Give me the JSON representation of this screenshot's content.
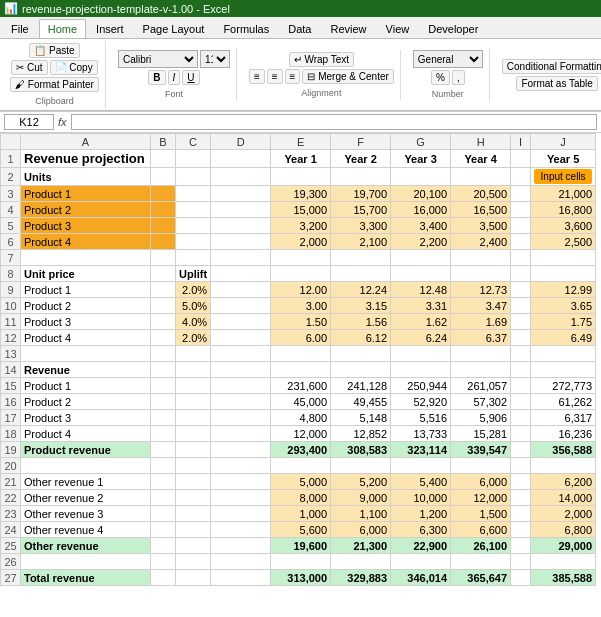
{
  "title": "revenue-projection-template-v-1.00 - Excel",
  "tabs": [
    "File",
    "Home",
    "Insert",
    "Page Layout",
    "Formulas",
    "Data",
    "Review",
    "View",
    "Developer"
  ],
  "active_tab": "Home",
  "cell_ref": "K12",
  "formula": "",
  "columns": [
    "A",
    "B",
    "C",
    "D",
    "E",
    "F",
    "G",
    "H",
    "I",
    "J"
  ],
  "input_cells_label": "Input cells",
  "rows": [
    {
      "row": 1,
      "a": "Revenue projection",
      "d": "",
      "e": "Year 1",
      "f": "Year 2",
      "g": "Year 3",
      "h": "Year 4",
      "i": "",
      "j": "Year 5"
    },
    {
      "row": 2,
      "a": "Units",
      "d": "",
      "e": "",
      "f": "",
      "g": "",
      "h": "",
      "i": "",
      "j": ""
    },
    {
      "row": 3,
      "a": "Product 1",
      "d": "",
      "e": "19,300",
      "f": "19,700",
      "g": "20,100",
      "h": "20,500",
      "i": "",
      "j": "21,000"
    },
    {
      "row": 4,
      "a": "Product 2",
      "d": "",
      "e": "15,000",
      "f": "15,700",
      "g": "16,000",
      "h": "16,500",
      "i": "",
      "j": "16,800"
    },
    {
      "row": 5,
      "a": "Product 3",
      "d": "",
      "e": "3,200",
      "f": "3,300",
      "g": "3,400",
      "h": "3,500",
      "i": "",
      "j": "3,600"
    },
    {
      "row": 6,
      "a": "Product 4",
      "d": "",
      "e": "2,000",
      "f": "2,100",
      "g": "2,200",
      "h": "2,400",
      "i": "",
      "j": "2,500"
    },
    {
      "row": 7,
      "a": "",
      "d": "",
      "e": "",
      "f": "",
      "g": "",
      "h": "",
      "i": "",
      "j": ""
    },
    {
      "row": 8,
      "a": "Unit price",
      "b": "",
      "c": "Uplift",
      "d": "",
      "e": "",
      "f": "",
      "g": "",
      "h": "",
      "i": "",
      "j": ""
    },
    {
      "row": 9,
      "a": "Product 1",
      "c": "2.0%",
      "d": "",
      "e": "12.00",
      "f": "12.24",
      "g": "12.48",
      "h": "12.73",
      "i": "",
      "j": "12.99"
    },
    {
      "row": 10,
      "a": "Product 2",
      "c": "5.0%",
      "d": "",
      "e": "3.00",
      "f": "3.15",
      "g": "3.31",
      "h": "3.47",
      "i": "",
      "j": "3.65"
    },
    {
      "row": 11,
      "a": "Product 3",
      "c": "4.0%",
      "d": "",
      "e": "1.50",
      "f": "1.56",
      "g": "1.62",
      "h": "1.69",
      "i": "",
      "j": "1.75"
    },
    {
      "row": 12,
      "a": "Product 4",
      "c": "2.0%",
      "d": "",
      "e": "6.00",
      "f": "6.12",
      "g": "6.24",
      "h": "6.37",
      "i": "",
      "j": "6.49"
    },
    {
      "row": 13,
      "a": "",
      "d": "",
      "e": "",
      "f": "",
      "g": "",
      "h": "",
      "i": "",
      "j": ""
    },
    {
      "row": 14,
      "a": "Revenue",
      "d": "",
      "e": "",
      "f": "",
      "g": "",
      "h": "",
      "i": "",
      "j": ""
    },
    {
      "row": 15,
      "a": "Product 1",
      "d": "",
      "e": "231,600",
      "f": "241,128",
      "g": "250,944",
      "h": "261,057",
      "i": "",
      "j": "272,773"
    },
    {
      "row": 16,
      "a": "Product 2",
      "d": "",
      "e": "45,000",
      "f": "49,455",
      "g": "52,920",
      "h": "57,302",
      "i": "",
      "j": "61,262"
    },
    {
      "row": 17,
      "a": "Product 3",
      "d": "",
      "e": "4,800",
      "f": "5,148",
      "g": "5,516",
      "h": "5,906",
      "i": "",
      "j": "6,317"
    },
    {
      "row": 18,
      "a": "Product 4",
      "d": "",
      "e": "12,000",
      "f": "12,852",
      "g": "13,733",
      "h": "15,281",
      "i": "",
      "j": "16,236"
    },
    {
      "row": 19,
      "a": "Product revenue",
      "d": "",
      "e": "293,400",
      "f": "308,583",
      "g": "323,114",
      "h": "339,547",
      "i": "",
      "j": "356,588"
    },
    {
      "row": 20,
      "a": "",
      "d": "",
      "e": "",
      "f": "",
      "g": "",
      "h": "",
      "i": "",
      "j": ""
    },
    {
      "row": 21,
      "a": "Other revenue 1",
      "d": "",
      "e": "5,000",
      "f": "5,200",
      "g": "5,400",
      "h": "6,000",
      "i": "",
      "j": "6,200"
    },
    {
      "row": 22,
      "a": "Other revenue 2",
      "d": "",
      "e": "8,000",
      "f": "9,000",
      "g": "10,000",
      "h": "12,000",
      "i": "",
      "j": "14,000"
    },
    {
      "row": 23,
      "a": "Other revenue 3",
      "d": "",
      "e": "1,000",
      "f": "1,100",
      "g": "1,200",
      "h": "1,500",
      "i": "",
      "j": "2,000"
    },
    {
      "row": 24,
      "a": "Other revenue 4",
      "d": "",
      "e": "5,600",
      "f": "6,000",
      "g": "6,300",
      "h": "6,600",
      "i": "",
      "j": "6,800"
    },
    {
      "row": 25,
      "a": "Other revenue",
      "d": "",
      "e": "19,600",
      "f": "21,300",
      "g": "22,900",
      "h": "26,100",
      "i": "",
      "j": "29,000"
    },
    {
      "row": 26,
      "a": "",
      "d": "",
      "e": "",
      "f": "",
      "g": "",
      "h": "",
      "i": "",
      "j": ""
    },
    {
      "row": 27,
      "a": "Total revenue",
      "d": "",
      "e": "313,000",
      "f": "329,883",
      "g": "346,014",
      "h": "365,647",
      "i": "",
      "j": "385,588"
    }
  ]
}
